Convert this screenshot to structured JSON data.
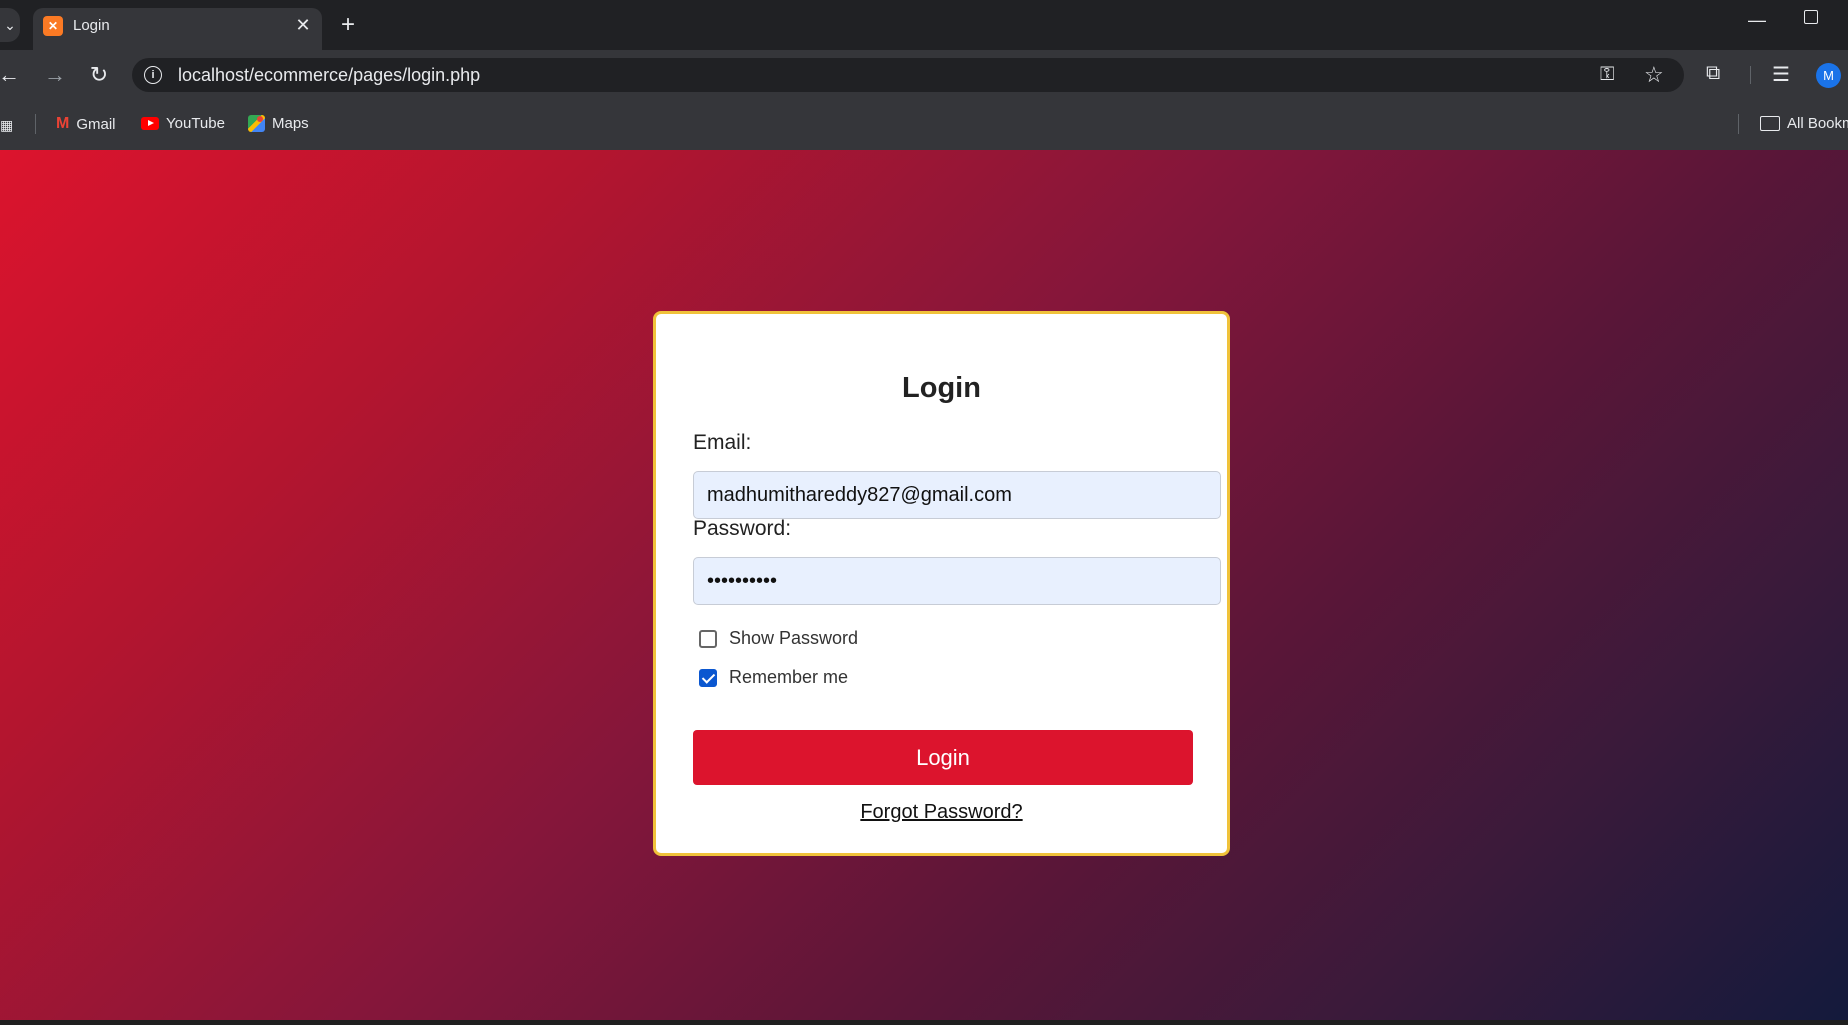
{
  "browser": {
    "tab": {
      "title": "Login",
      "favicon": "xampp-favicon"
    },
    "address_bar": {
      "url": "localhost/ecommerce/pages/login.php"
    },
    "avatar_initial": "M",
    "bookmarks": [
      {
        "label": "Gmail",
        "icon": "gmail-icon"
      },
      {
        "label": "YouTube",
        "icon": "youtube-icon"
      },
      {
        "label": "Maps",
        "icon": "maps-icon"
      }
    ],
    "all_bookmarks_label": "All Bookm"
  },
  "login_form": {
    "title": "Login",
    "email_label": "Email:",
    "email_value": "madhumithareddy827@gmail.com",
    "password_label": "Password:",
    "password_value": "••••••••••",
    "show_password_label": "Show Password",
    "show_password_checked": false,
    "remember_me_label": "Remember me",
    "remember_me_checked": true,
    "submit_label": "Login",
    "forgot_password_label": "Forgot Password?"
  },
  "colors": {
    "accent": "#dc142d",
    "card_border": "#f0c23a",
    "gradient_start": "#dc142d",
    "gradient_end": "#131a3c",
    "checkbox_checked": "#0b57d0"
  }
}
